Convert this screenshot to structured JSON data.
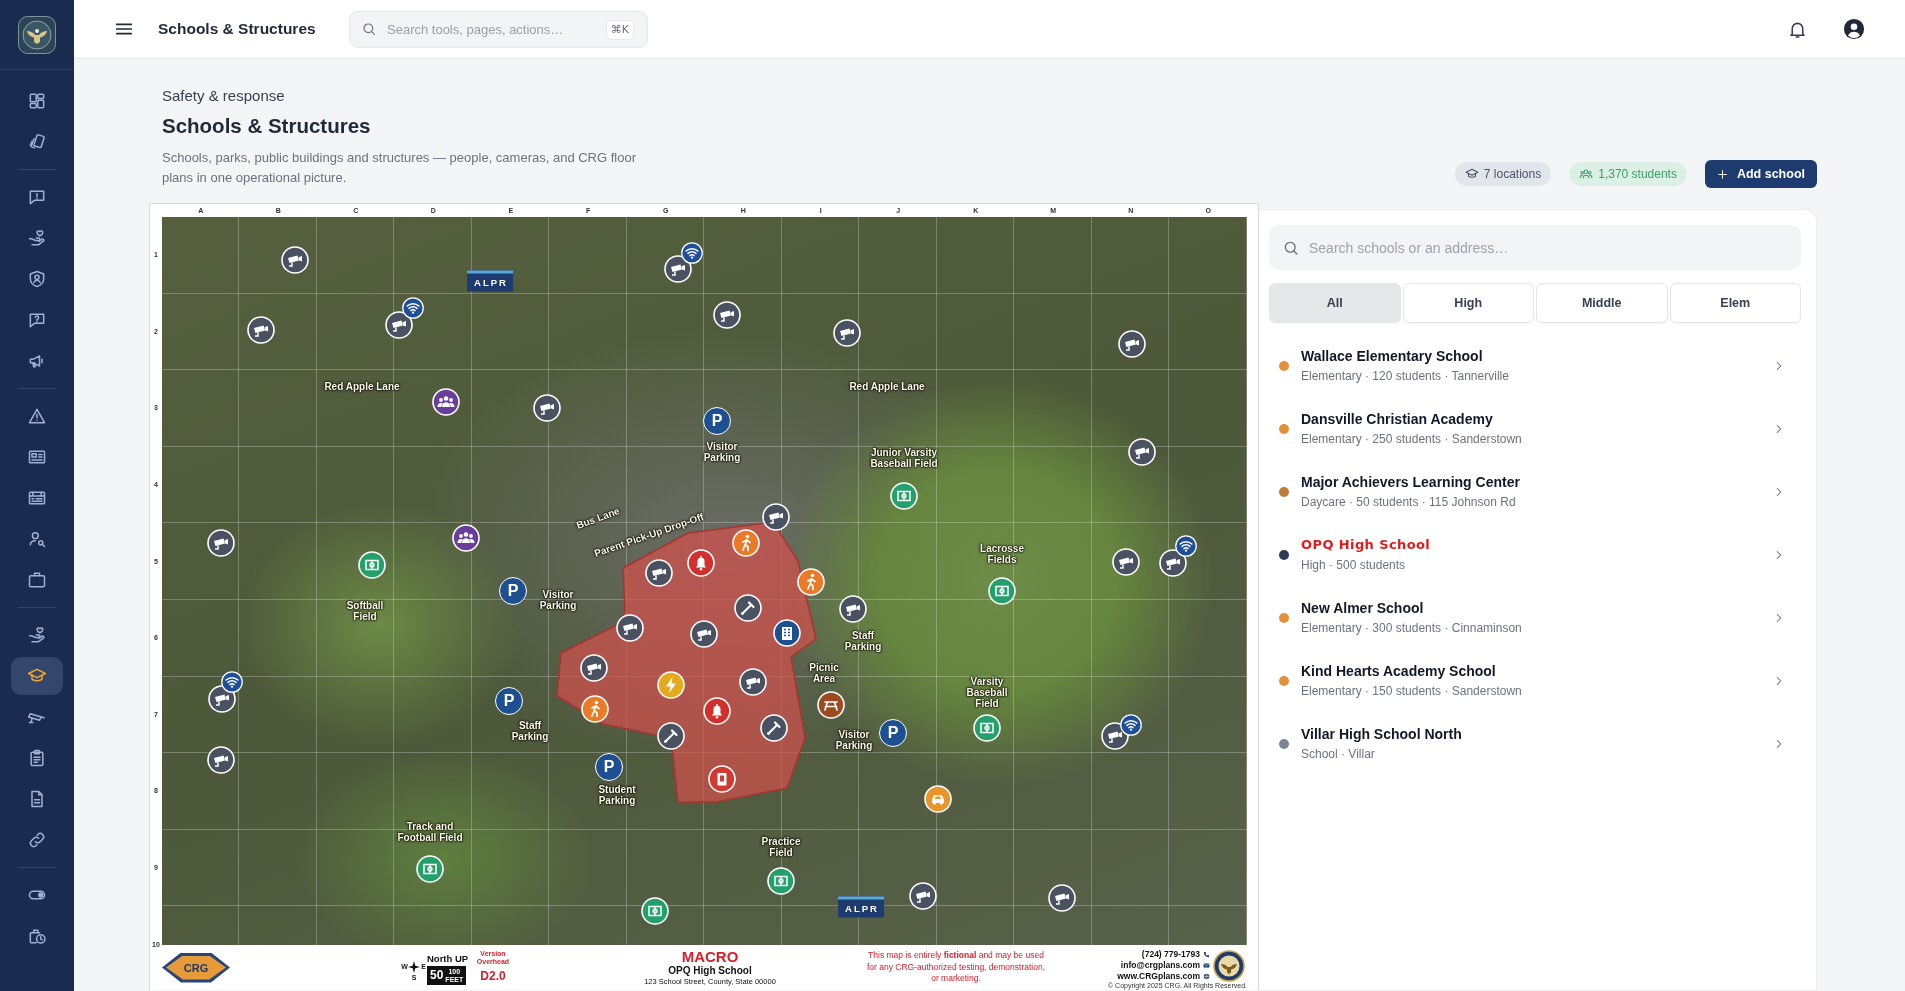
{
  "sidebar": {
    "groups": [
      {
        "items": [
          {
            "selected": false
          },
          {
            "selected": false
          }
        ]
      },
      {
        "items": [
          {
            "selected": false
          },
          {
            "selected": false
          },
          {
            "selected": false
          },
          {
            "selected": false
          },
          {
            "selected": false
          }
        ]
      },
      {
        "items": [
          {
            "selected": false
          },
          {
            "selected": false
          },
          {
            "selected": false
          },
          {
            "selected": false
          },
          {
            "selected": false
          }
        ]
      },
      {
        "items": [
          {
            "selected": false
          },
          {
            "selected": true
          },
          {
            "selected": false
          },
          {
            "selected": false
          },
          {
            "selected": false
          },
          {
            "selected": false
          }
        ]
      },
      {
        "items": [
          {
            "selected": false
          },
          {
            "selected": false
          }
        ]
      }
    ]
  },
  "top_bar": {
    "title": "Schools & Structures",
    "search": {
      "placeholder": "Search tools, pages, actions…",
      "shortcut": "⌘K"
    }
  },
  "header": {
    "eyebrow": "Safety & response",
    "title": "Schools & Structures",
    "description": "Schools, parks, public buildings and structures — people, cameras, and CRG floor plans in one operational picture.",
    "stats": [
      {
        "kind": "locations",
        "label": "7 locations"
      },
      {
        "kind": "students",
        "label": "1,370 students"
      }
    ],
    "primary_action": "Add school"
  },
  "map": {
    "column_labels": [
      "A",
      "B",
      "C",
      "D",
      "E",
      "F",
      "G",
      "H",
      "I",
      "J",
      "K",
      "M",
      "N",
      "O"
    ],
    "row_labels": [
      "1",
      "2",
      "3",
      "4",
      "5",
      "6",
      "7",
      "8",
      "9",
      "10"
    ],
    "place_labels": [
      "Red Apple Lane",
      "Red Apple Lane",
      "Visitor Parking",
      "Junior Varsity Baseball Field",
      "Bus Lane",
      "Parent Pick-Up Drop-Off",
      "Lacrosse Fields",
      "Softball Field",
      "Visitor Parking",
      "Staff Parking",
      "Picnic Area",
      "Varsity Baseball Field",
      "Staff Parking",
      "Visitor Parking",
      "Student Parking",
      "Track and Football Field",
      "Practice Field"
    ],
    "alpr_signs": [
      "ALPR",
      "ALPR"
    ],
    "parking_markers": [
      "P",
      "P",
      "P",
      "P",
      "P"
    ],
    "title_block": {
      "logo": "CRG",
      "compass_letters": [
        "W",
        "E",
        "S"
      ],
      "north": "North UP",
      "scale": [
        "50",
        "100",
        "FEET"
      ],
      "version_label": "Version Overhead",
      "version": "D2.0",
      "plan_type": "MACRO",
      "school": "OPQ High School",
      "address": "123 School Street, County, State 00000",
      "disclaimer": "This map is entirely **fictional** and may be used for any CRG-authorized testing, demonstration, or marketing.",
      "contacts": [
        {
          "kind": "phone",
          "text": "(724) 779-1793"
        },
        {
          "kind": "email",
          "text": "info@crgplans.com"
        },
        {
          "kind": "web",
          "text": "www.CRGplans.com"
        }
      ],
      "copyright": "© Copyright 2025 CRG. All Rights Reserved."
    }
  },
  "panel": {
    "search": {
      "placeholder": "Search schools or an address…"
    },
    "filters": [
      {
        "label": "All",
        "selected": true
      },
      {
        "label": "High",
        "selected": false
      },
      {
        "label": "Middle",
        "selected": false
      },
      {
        "label": "Elem",
        "selected": false
      }
    ],
    "schools": [
      {
        "name": "Wallace Elementary School",
        "details": "Elementary · 120 students · Tannerville",
        "color": "#e3923a",
        "selected": false
      },
      {
        "name": "Dansville Christian Academy",
        "details": "Elementary · 250 students · Sanderstown",
        "color": "#e3923a",
        "selected": false
      },
      {
        "name": "Major Achievers Learning Center",
        "details": "Daycare · 50 students · 115 Johnson Rd",
        "color": "#c27a34",
        "selected": false
      },
      {
        "name": "OPQ High School",
        "details": "High · 500 students",
        "color": "#2b3a55",
        "selected": true
      },
      {
        "name": "New Almer School",
        "details": "Elementary · 300 students · Cinnaminson",
        "color": "#e3923a",
        "selected": false
      },
      {
        "name": "Kind Hearts Academy School",
        "details": "Elementary · 150 students · Sanderstown",
        "color": "#e3923a",
        "selected": false
      },
      {
        "name": "Villar High School North",
        "details": "School · Villar",
        "color": "#7b8491",
        "selected": false
      }
    ]
  }
}
